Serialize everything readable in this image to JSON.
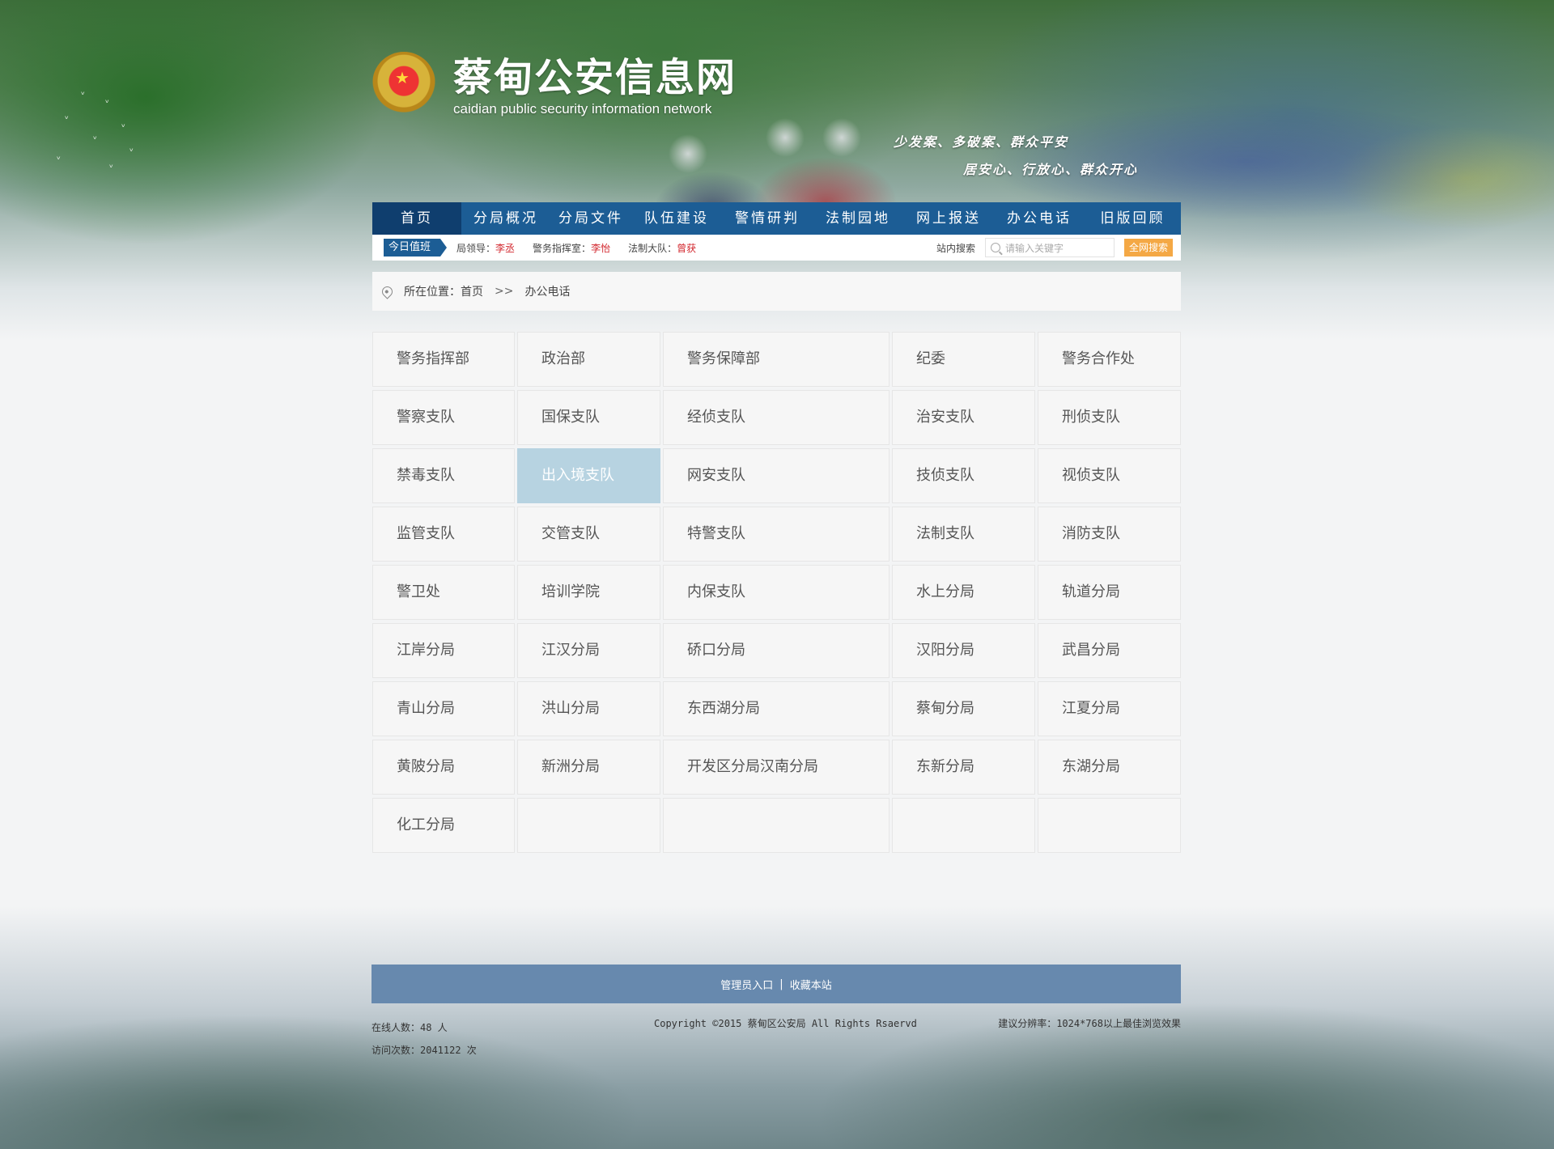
{
  "header": {
    "site_title": "蔡甸公安信息网",
    "site_subtitle": "caidian  public security information network",
    "slogan_line1": "少发案、多破案、群众平安",
    "slogan_line2": "居安心、行放心、群众开心"
  },
  "nav": {
    "items": [
      {
        "label": "首页",
        "active": true
      },
      {
        "label": "分局概况"
      },
      {
        "label": "分局文件"
      },
      {
        "label": "队伍建设"
      },
      {
        "label": "警情研判"
      },
      {
        "label": "法制园地"
      },
      {
        "label": "网上报送"
      },
      {
        "label": "办公电话"
      },
      {
        "label": "旧版回顾"
      }
    ]
  },
  "duty": {
    "tag": "今日值班",
    "leader_label": "局领导：",
    "leader_name": "李丞",
    "command_label": "警务指挥室：",
    "command_name": "李怡",
    "legal_label": "法制大队：",
    "legal_name": "曾获"
  },
  "search": {
    "label": "站内搜索",
    "placeholder": "请输入关键字",
    "button": "全网搜索"
  },
  "breadcrumb": {
    "prefix": "所在位置：",
    "home": "首页",
    "separator": ">>",
    "current": "办公电话"
  },
  "departments": [
    [
      "警务指挥部",
      "政治部",
      "警务保障部",
      "纪委",
      "警务合作处"
    ],
    [
      "警察支队",
      "国保支队",
      "经侦支队",
      "治安支队",
      "刑侦支队"
    ],
    [
      "禁毒支队",
      "出入境支队",
      "网安支队",
      "技侦支队",
      "视侦支队"
    ],
    [
      "监管支队",
      "交管支队",
      "特警支队",
      "法制支队",
      "消防支队"
    ],
    [
      "警卫处",
      "培训学院",
      "内保支队",
      "水上分局",
      "轨道分局"
    ],
    [
      "江岸分局",
      "江汉分局",
      "硚口分局",
      "汉阳分局",
      "武昌分局"
    ],
    [
      "青山分局",
      "洪山分局",
      "东西湖分局",
      "蔡甸分局",
      "江夏分局"
    ],
    [
      "黄陂分局",
      "新洲分局",
      "开发区分局汉南分局",
      "东新分局",
      "东湖分局"
    ],
    [
      "化工分局",
      "",
      "",
      "",
      ""
    ]
  ],
  "highlighted_department": "出入境支队",
  "footer": {
    "admin_link": "管理员入口",
    "divider": "|",
    "bookmark_link": "收藏本站",
    "online_users": "在线人数：48 人",
    "visits": "访问次数：2041122 次",
    "copyright": "Copyright ©2015  蔡甸区公安局  All Rights Rsaervd",
    "resolution_tip": "建议分辨率：1024*768以上最佳浏览效果"
  },
  "colors": {
    "nav_bg": "#1c5d95",
    "nav_active": "#0f3e6e",
    "highlight_cell": "#b7d3e1",
    "footer_bar": "#6789ae",
    "search_button": "#f4a845",
    "duty_name": "#d2262d"
  }
}
